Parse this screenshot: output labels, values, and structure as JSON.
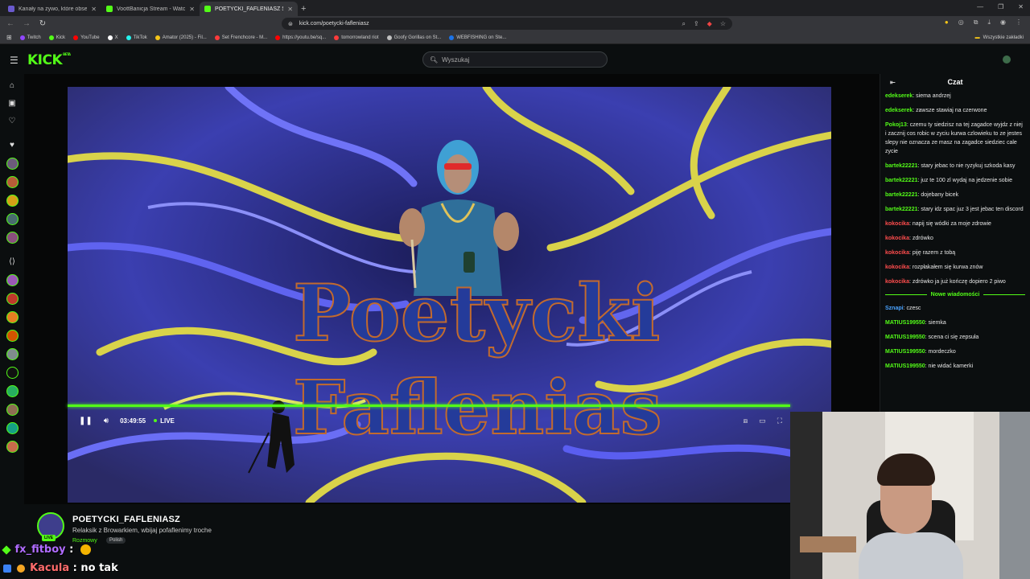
{
  "browser": {
    "tabs": [
      {
        "label": "Kanały na żywo, które obserwuje",
        "color": "#6a5acd",
        "active": false
      },
      {
        "label": "VoottBanicja Stream - Watch Live on",
        "color": "#53fc18",
        "active": false
      },
      {
        "label": "POETYCKI_FAFLENIASZ Stream",
        "color": "#53fc18",
        "active": true
      }
    ],
    "url": "kick.com/poetycki-fafleniasz",
    "bookmarks": [
      {
        "label": "Twitch",
        "color": "#9146ff"
      },
      {
        "label": "Kick",
        "color": "#53fc18"
      },
      {
        "label": "YouTube",
        "color": "#ff0000"
      },
      {
        "label": "X",
        "color": "#ffffff"
      },
      {
        "label": "TikTok",
        "color": "#25f4ee"
      },
      {
        "label": "Amator (2025) - Fil...",
        "color": "#f5c518"
      },
      {
        "label": "Set Frenchcore - M...",
        "color": "#ff3b3b"
      },
      {
        "label": "https://youtu.be/sq...",
        "color": "#ff0000"
      },
      {
        "label": "tomorrowland riot",
        "color": "#ff3b3b"
      },
      {
        "label": "Goofy Gorillas on St...",
        "color": "#c0c0c0"
      },
      {
        "label": "WEBFISHING on Ste...",
        "color": "#1b73e8"
      }
    ],
    "all_bookmarks": "Wszystkie zakładki"
  },
  "header": {
    "logo": "KICK",
    "logo_sup": "BETA",
    "search_placeholder": "Wyszukaj"
  },
  "player": {
    "title_line1": "Poetycki",
    "title_line2": "Faflenias",
    "time": "03:49:55",
    "live": "LIVE"
  },
  "stream": {
    "name": "POETYCKI_FAFLENIASZ",
    "title": "Relaksik z Browarkiem, wbijaj pofaflenimy troche",
    "category": "Rozmowy",
    "language": "Polish",
    "live_badge": "LIVE"
  },
  "overlay_chat": [
    {
      "user": "fx_fitboy",
      "text": ":"
    },
    {
      "user": "Kacula",
      "text": ": no tak"
    }
  ],
  "chat": {
    "title": "Czat",
    "separator": "Nowe wiadomości",
    "messages": [
      {
        "user": "edekserek",
        "color": "#53fc18",
        "text": ": siema andrzej"
      },
      {
        "user": "edekserek",
        "color": "#53fc18",
        "text": ": zawsze stawiaj na czerwone"
      },
      {
        "user": "Pokoj13",
        "color": "#53fc18",
        "text": ": czemu ty siedzisz na tej zagadce wyjdz z niej i zacznij cos robic w zyciu kurwa czlowieku to ze jestes slepy nie oznacza ze masz na zagadce siedziec cale zycie"
      },
      {
        "user": "bartek22221",
        "color": "#53fc18",
        "text": ": stary jebac to nie ryzykuj szkoda kasy"
      },
      {
        "user": "bartek22221",
        "color": "#53fc18",
        "text": ": juz te 100 zl wydaj na jedzenie sobie"
      },
      {
        "user": "bartek22221",
        "color": "#53fc18",
        "text": ": dojebany bicek"
      },
      {
        "user": "bartek22221",
        "color": "#53fc18",
        "text": ": stary idz spac juz 3 jest jebac ten discord"
      },
      {
        "user": "kokocika",
        "color": "#ff4d4d",
        "text": ": napij się wódki za moje zdrowie"
      },
      {
        "user": "kokocika",
        "color": "#ff4d4d",
        "text": ": zdrówko"
      },
      {
        "user": "kokocika",
        "color": "#ff4d4d",
        "text": ": piję razem z tobą"
      },
      {
        "user": "kokocika",
        "color": "#ff4d4d",
        "text": ": rozpłakałem się kurwa znów"
      },
      {
        "user": "kokocika",
        "color": "#ff4d4d",
        "text": ": zdrówko ja już kończę dopiero 2 piwo"
      }
    ],
    "new_messages": [
      {
        "user": "Sznapi",
        "color": "#4aa3ff",
        "text": ": czesc"
      },
      {
        "user": "MATIUS199550",
        "color": "#53fc18",
        "text": ": siemka"
      },
      {
        "user": "MATIUS199550",
        "color": "#53fc18",
        "text": ": scena ci się zepsuła"
      },
      {
        "user": "MATIUS199550",
        "color": "#53fc18",
        "text": ": mordeczko"
      },
      {
        "user": "MATIUS199550",
        "color": "#53fc18",
        "text": ": nie widać kamerki"
      }
    ]
  }
}
